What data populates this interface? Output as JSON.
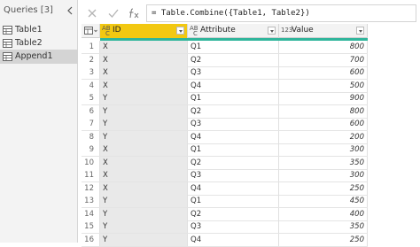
{
  "queries_pane": {
    "title": "Queries [3]",
    "items": [
      {
        "label": "Table1"
      },
      {
        "label": "Table2"
      },
      {
        "label": "Append1",
        "selected": true
      }
    ]
  },
  "formula_bar": {
    "formula": "= Table.Combine({Table1, Table2})"
  },
  "grid": {
    "columns": [
      {
        "label": "ID",
        "type_label": "ABC"
      },
      {
        "label": "Attribute",
        "type_label": "ABC"
      },
      {
        "label": "Value",
        "type_label": "123"
      }
    ],
    "rows": [
      {
        "n": "1",
        "id": "X",
        "attr": "Q1",
        "value": "800"
      },
      {
        "n": "2",
        "id": "X",
        "attr": "Q2",
        "value": "700"
      },
      {
        "n": "3",
        "id": "X",
        "attr": "Q3",
        "value": "600"
      },
      {
        "n": "4",
        "id": "X",
        "attr": "Q4",
        "value": "500"
      },
      {
        "n": "5",
        "id": "Y",
        "attr": "Q1",
        "value": "900"
      },
      {
        "n": "6",
        "id": "Y",
        "attr": "Q2",
        "value": "800"
      },
      {
        "n": "7",
        "id": "Y",
        "attr": "Q3",
        "value": "600"
      },
      {
        "n": "8",
        "id": "Y",
        "attr": "Q4",
        "value": "200"
      },
      {
        "n": "9",
        "id": "X",
        "attr": "Q1",
        "value": "300"
      },
      {
        "n": "10",
        "id": "X",
        "attr": "Q2",
        "value": "350"
      },
      {
        "n": "11",
        "id": "X",
        "attr": "Q3",
        "value": "300"
      },
      {
        "n": "12",
        "id": "X",
        "attr": "Q4",
        "value": "250"
      },
      {
        "n": "13",
        "id": "Y",
        "attr": "Q1",
        "value": "450"
      },
      {
        "n": "14",
        "id": "Y",
        "attr": "Q2",
        "value": "400"
      },
      {
        "n": "15",
        "id": "Y",
        "attr": "Q3",
        "value": "350"
      },
      {
        "n": "16",
        "id": "Y",
        "attr": "Q4",
        "value": "250"
      }
    ]
  },
  "colors": {
    "selected_column_header": "#f2c811",
    "column_quality_bar": "#2fb59b",
    "selected_query": "#d4d4d4"
  },
  "icons": {
    "cancel": "close-icon",
    "confirm": "check-icon",
    "function": "fx-icon",
    "collapse": "chevron-left-icon",
    "table": "table-icon"
  }
}
